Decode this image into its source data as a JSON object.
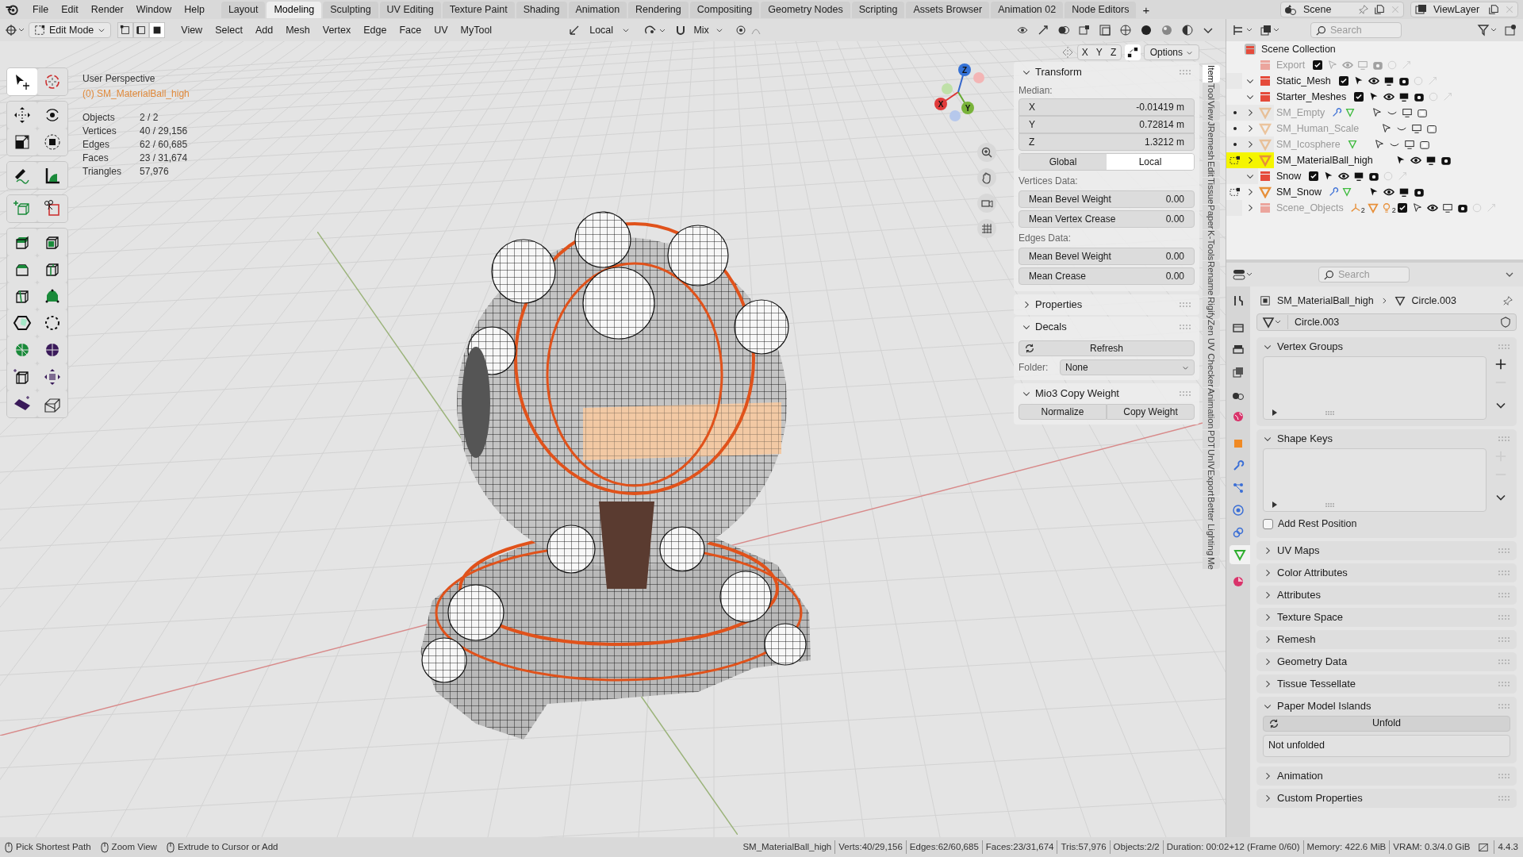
{
  "top_bar": {
    "menus": [
      "File",
      "Edit",
      "Render",
      "Window",
      "Help"
    ],
    "workspaces": [
      {
        "label": "Layout",
        "selected": false
      },
      {
        "label": "Modeling",
        "selected": true
      },
      {
        "label": "Sculpting",
        "selected": false
      },
      {
        "label": "UV Editing",
        "selected": false
      },
      {
        "label": "Texture Paint",
        "selected": false
      },
      {
        "label": "Shading",
        "selected": false
      },
      {
        "label": "Animation",
        "selected": false
      },
      {
        "label": "Rendering",
        "selected": false
      },
      {
        "label": "Compositing",
        "selected": false
      },
      {
        "label": "Geometry Nodes",
        "selected": false
      },
      {
        "label": "Scripting",
        "selected": false
      },
      {
        "label": "Assets Browser",
        "selected": false
      },
      {
        "label": "Animation 02",
        "selected": false
      },
      {
        "label": "Node Editors",
        "selected": false
      }
    ],
    "add_workspace": "+",
    "scene": "Scene",
    "view_layer": "ViewLayer"
  },
  "viewport_header": {
    "mode": "Edit Mode",
    "select_modes": [
      {
        "selected": false
      },
      {
        "selected": false
      },
      {
        "selected": true
      }
    ],
    "menus": [
      "View",
      "Select",
      "Add",
      "Mesh",
      "Vertex",
      "Edge",
      "Face",
      "UV",
      "MyTool"
    ],
    "orientation": "Local",
    "snap": "Mix"
  },
  "viewport": {
    "view_name": "User Perspective",
    "object_label": "(0) SM_MaterialBall_high",
    "stats": [
      {
        "label": "Objects",
        "value": "2 / 2"
      },
      {
        "label": "Vertices",
        "value": "40 / 29,156"
      },
      {
        "label": "Edges",
        "value": "62 / 60,685"
      },
      {
        "label": "Faces",
        "value": "23 / 31,674"
      },
      {
        "label": "Triangles",
        "value": "57,976"
      }
    ],
    "gizmo_labels": [
      "Z",
      "X",
      "Y"
    ]
  },
  "toolbar": {
    "groups": [
      {
        "tools": [
          {
            "kind": "select",
            "selected": true
          },
          {
            "kind": "cursor",
            "selected": false
          }
        ]
      },
      {
        "tools": [
          {
            "kind": "move",
            "selected": false
          },
          {
            "kind": "rotate",
            "selected": false
          },
          {
            "kind": "scale",
            "selected": false
          },
          {
            "kind": "transform",
            "selected": false
          }
        ]
      },
      {
        "tools": [
          {
            "kind": "annotate",
            "selected": false
          },
          {
            "kind": "measure",
            "selected": false
          }
        ]
      },
      {
        "tools": [
          {
            "kind": "add_cube",
            "selected": false
          },
          {
            "kind": "cut",
            "selected": false
          }
        ]
      },
      {
        "tools": [
          {
            "kind": "extrude",
            "selected": false
          },
          {
            "kind": "inset",
            "selected": false
          },
          {
            "kind": "bevel",
            "selected": false
          },
          {
            "kind": "loop_cut",
            "selected": false
          },
          {
            "kind": "knife",
            "selected": false
          },
          {
            "kind": "poly_build",
            "selected": false
          },
          {
            "kind": "spin",
            "selected": false
          },
          {
            "kind": "dashed_circle",
            "selected": false
          },
          {
            "kind": "smooth",
            "selected": false
          },
          {
            "kind": "sphere",
            "selected": false
          },
          {
            "kind": "edge_slide",
            "selected": false
          },
          {
            "kind": "shrink",
            "selected": false
          },
          {
            "kind": "slab",
            "selected": false
          },
          {
            "kind": "shear",
            "selected": false
          }
        ]
      }
    ]
  },
  "sidebar": {
    "mirror_axes": [
      "X",
      "Y",
      "Z"
    ],
    "options": "Options",
    "transform": {
      "title": "Transform",
      "expanded": true,
      "median_label": "Median:",
      "fields": [
        {
          "label": "X",
          "value": "-0.01419 m"
        },
        {
          "label": "Y",
          "value": "0.72814 m"
        },
        {
          "label": "Z",
          "value": "1.3212 m"
        }
      ],
      "space": [
        {
          "label": "Global",
          "selected": false
        },
        {
          "label": "Local",
          "selected": true
        }
      ],
      "vertices_label": "Vertices Data:",
      "vertex_fields": [
        {
          "label": "Mean Bevel Weight",
          "value": "0.00"
        },
        {
          "label": "Mean Vertex Crease",
          "value": "0.00"
        }
      ],
      "edges_label": "Edges Data:",
      "edge_fields": [
        {
          "label": "Mean Bevel Weight",
          "value": "0.00"
        },
        {
          "label": "Mean Crease",
          "value": "0.00"
        }
      ]
    },
    "properties": {
      "title": "Properties",
      "expanded": false
    },
    "decals": {
      "title": "Decals",
      "expanded": true,
      "refresh": "Refresh",
      "folder_label": "Folder:",
      "folder": "None"
    },
    "copy_weight": {
      "title": "Mio3 Copy Weight",
      "expanded": true,
      "buttons": [
        "Normalize",
        "Copy Weight"
      ]
    },
    "tabs": [
      {
        "label": "Item",
        "selected": true
      },
      {
        "label": "Tool",
        "selected": false
      },
      {
        "label": "View",
        "selected": false
      },
      {
        "label": "JRemesh",
        "selected": false
      },
      {
        "label": "Edit",
        "selected": false
      },
      {
        "label": "Tissue",
        "selected": false
      },
      {
        "label": "Paper",
        "selected": false
      },
      {
        "label": "K-Tools",
        "selected": false
      },
      {
        "label": "Rename",
        "selected": false
      },
      {
        "label": "Rigify",
        "selected": false
      },
      {
        "label": "Zen UV Checker",
        "selected": false
      },
      {
        "label": "Animation",
        "selected": false
      },
      {
        "label": "PDT",
        "selected": false
      },
      {
        "label": "UnIV",
        "selected": false
      },
      {
        "label": "Export",
        "selected": false
      },
      {
        "label": "Better Lighting",
        "selected": false
      },
      {
        "label": "Me",
        "selected": false
      }
    ]
  },
  "outliner": {
    "search_placeholder": "Search",
    "root": "Scene Collection",
    "rows": [
      {
        "name": "Export",
        "kind": "collection",
        "dimmed": true,
        "checked": true,
        "selected": false
      },
      {
        "name": "Static_Mesh",
        "kind": "collection",
        "expanded": true,
        "dimmed": false,
        "checked": true,
        "selected": false,
        "children": [
          {
            "name": "Starter_Meshes",
            "kind": "collection",
            "expanded": true,
            "dimmed": false,
            "checked": true,
            "selected": false,
            "children": [
              {
                "name": "SM_Empty",
                "kind": "object",
                "expanded": false,
                "dimmed": true,
                "selected": false,
                "edit_mode": false,
                "badges": [
                  {
                    "kind": "modifier"
                  },
                  {
                    "kind": "mesh"
                  }
                ]
              },
              {
                "name": "SM_Human_Scale",
                "kind": "object",
                "expanded": false,
                "dimmed": true,
                "selected": false,
                "edit_mode": false
              },
              {
                "name": "SM_Icosphere",
                "kind": "object",
                "expanded": false,
                "dimmed": true,
                "selected": false,
                "edit_mode": false,
                "badges": [
                  {
                    "kind": "mesh"
                  }
                ]
              },
              {
                "name": "SM_MaterialBall_high",
                "kind": "object",
                "expanded": false,
                "dimmed": false,
                "selected": true,
                "edit_mode": true
              }
            ]
          },
          {
            "name": "Snow",
            "kind": "collection",
            "expanded": true,
            "dimmed": false,
            "checked": true,
            "selected": false,
            "children": [
              {
                "name": "SM_Snow",
                "kind": "object",
                "expanded": false,
                "dimmed": false,
                "selected": false,
                "edit_mode": true,
                "badges": [
                  {
                    "kind": "modifier"
                  },
                  {
                    "kind": "mesh"
                  }
                ]
              }
            ]
          }
        ]
      },
      {
        "name": "Scene_Objects",
        "kind": "collection",
        "expanded": false,
        "dimmed": true,
        "checked": true,
        "selected": false,
        "badges": [
          {
            "kind": "empty",
            "count": "2"
          },
          {
            "kind": "object"
          },
          {
            "kind": "light",
            "count": "2"
          }
        ]
      }
    ]
  },
  "properties": {
    "search_placeholder": "Search",
    "tabs": [
      {
        "kind": "tool",
        "selected": false
      },
      {
        "kind": "render",
        "selected": false
      },
      {
        "kind": "output",
        "selected": false
      },
      {
        "kind": "view_layer",
        "selected": false
      },
      {
        "kind": "scene",
        "selected": false
      },
      {
        "kind": "world",
        "selected": false
      },
      {
        "kind": "object",
        "selected": false
      },
      {
        "kind": "modifiers",
        "selected": false
      },
      {
        "kind": "particles",
        "selected": false
      },
      {
        "kind": "physics",
        "selected": false
      },
      {
        "kind": "constraints",
        "selected": false
      },
      {
        "kind": "data",
        "selected": true
      },
      {
        "kind": "material",
        "selected": false
      }
    ],
    "breadcrumb": [
      "SM_MaterialBall_high",
      "Circle.003"
    ],
    "mesh_name": "Circle.003",
    "panels": [
      {
        "title": "Vertex Groups",
        "expanded": true,
        "kind": "list"
      },
      {
        "title": "Shape Keys",
        "expanded": true,
        "kind": "list",
        "checkbox": {
          "label": "Add Rest Position",
          "checked": false
        }
      },
      {
        "title": "UV Maps",
        "expanded": false
      },
      {
        "title": "Color Attributes",
        "expanded": false
      },
      {
        "title": "Attributes",
        "expanded": false
      },
      {
        "title": "Texture Space",
        "expanded": false
      },
      {
        "title": "Remesh",
        "expanded": false
      },
      {
        "title": "Geometry Data",
        "expanded": false
      },
      {
        "title": "Tissue Tessellate",
        "expanded": false
      },
      {
        "title": "Paper Model Islands",
        "expanded": true,
        "kind": "unfold",
        "button": "Unfold",
        "message": "Not unfolded"
      },
      {
        "title": "Animation",
        "expanded": false
      },
      {
        "title": "Custom Properties",
        "expanded": false
      }
    ]
  },
  "status_bar": {
    "hints": [
      "Pick Shortest Path",
      "Zoom View",
      "Extrude to Cursor or Add"
    ],
    "stats": [
      "SM_MaterialBall_high",
      "Verts:40/29,156",
      "Edges:62/60,685",
      "Faces:23/31,674",
      "Tris:57,976",
      "Objects:2/2",
      "Duration: 00:02+12 (Frame 0/60)",
      "Memory: 422.6 MiB",
      "VRAM: 0.3/4.0 GiB"
    ],
    "version": "4.4.3"
  }
}
